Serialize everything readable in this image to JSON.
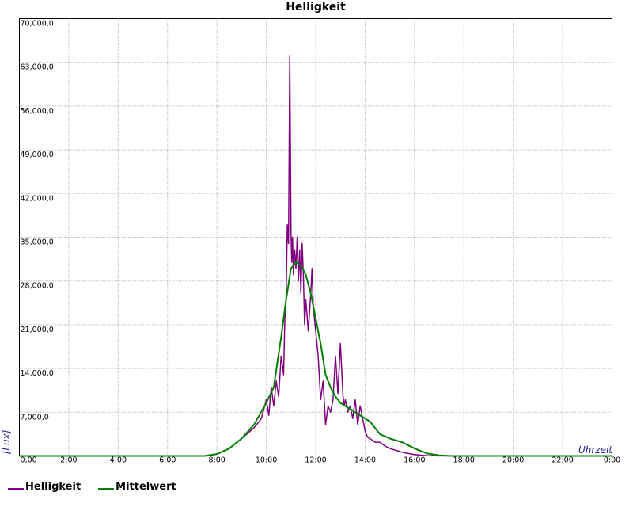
{
  "chart_data": {
    "type": "line",
    "title": "Helligkeit",
    "xlabel": "Uhrzeit",
    "ylabel": "[Lux]",
    "xlim": [
      0,
      24
    ],
    "ylim": [
      0,
      70000
    ],
    "grid": true,
    "legend_position": "bottom-left",
    "x_tick_labels": [
      "0,00",
      "2:00",
      "4:00",
      "6:00",
      "8:00",
      "10:00",
      "12:00",
      "14:00",
      "16:00",
      "18:00",
      "20:00",
      "22:00",
      "0:00"
    ],
    "y_tick_labels": [
      "7,000,0",
      "14,000,0",
      "21,000,0",
      "28,000,0",
      "35,000,0",
      "42,000,0",
      "49,000,0",
      "56,000,0",
      "63,000,0",
      "70,000,0"
    ],
    "y_tick_values": [
      7000,
      14000,
      21000,
      28000,
      35000,
      42000,
      49000,
      56000,
      63000,
      70000
    ],
    "series": [
      {
        "name": "Helligkeit",
        "color": "#800080",
        "x": [
          0,
          7.5,
          8.0,
          8.5,
          9.0,
          9.5,
          9.8,
          10.0,
          10.1,
          10.2,
          10.3,
          10.4,
          10.5,
          10.6,
          10.7,
          10.75,
          10.8,
          10.85,
          10.9,
          10.95,
          11.0,
          11.03,
          11.06,
          11.1,
          11.15,
          11.2,
          11.25,
          11.3,
          11.35,
          11.4,
          11.45,
          11.5,
          11.55,
          11.6,
          11.7,
          11.75,
          11.8,
          11.85,
          11.9,
          12.0,
          12.1,
          12.2,
          12.3,
          12.4,
          12.5,
          12.6,
          12.7,
          12.8,
          12.9,
          13.0,
          13.05,
          13.1,
          13.15,
          13.2,
          13.3,
          13.4,
          13.5,
          13.6,
          13.7,
          13.8,
          13.9,
          14.0,
          14.1,
          14.2,
          14.3,
          14.4,
          14.6,
          14.8,
          15.0,
          15.5,
          16.0,
          16.5,
          17.0,
          17.5,
          18.0,
          24.0
        ],
        "y": [
          0,
          0,
          300,
          1200,
          2800,
          4500,
          6000,
          9000,
          6500,
          11000,
          8000,
          12000,
          9500,
          16000,
          13000,
          22000,
          25000,
          37000,
          34000,
          64000,
          36000,
          31000,
          35000,
          29000,
          33000,
          30000,
          35000,
          28000,
          33000,
          26000,
          34000,
          29000,
          21000,
          25000,
          20000,
          23000,
          26000,
          30000,
          24000,
          20000,
          16000,
          9000,
          12000,
          5000,
          8000,
          7000,
          9000,
          16000,
          10000,
          18000,
          14000,
          10000,
          8000,
          9000,
          7000,
          8000,
          6000,
          9000,
          5000,
          8000,
          6000,
          4000,
          3000,
          2800,
          2500,
          2200,
          2200,
          1600,
          1200,
          600,
          200,
          50,
          10,
          0,
          0,
          0
        ]
      },
      {
        "name": "Mittelwert",
        "color": "#008000",
        "x": [
          0,
          7.5,
          8.0,
          8.5,
          9.0,
          9.5,
          10.0,
          10.3,
          10.6,
          10.8,
          11.0,
          11.2,
          11.4,
          11.6,
          11.8,
          12.0,
          12.2,
          12.4,
          12.6,
          12.8,
          13.0,
          13.4,
          13.8,
          14.2,
          14.6,
          15.0,
          15.5,
          16.0,
          16.5,
          17.0,
          17.5,
          18.0,
          24.0
        ],
        "y": [
          0,
          0,
          300,
          1200,
          2800,
          5000,
          8500,
          11000,
          19000,
          25000,
          30000,
          31000,
          30500,
          29000,
          26000,
          22000,
          18000,
          13000,
          11000,
          9500,
          8500,
          7500,
          6500,
          5500,
          3500,
          2800,
          2200,
          1200,
          400,
          100,
          0,
          0,
          0
        ]
      }
    ]
  }
}
